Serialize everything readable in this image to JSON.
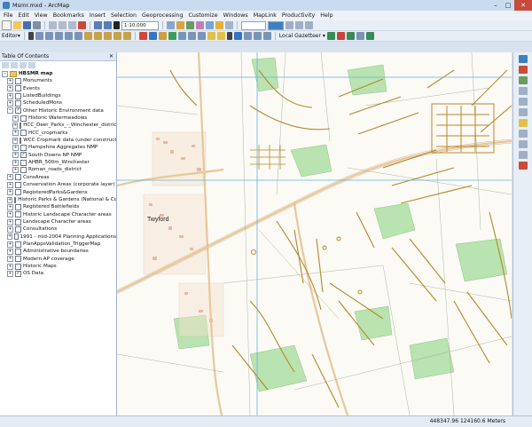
{
  "window": {
    "title": "Msmr.mxd - ArcMap",
    "minimize": "–",
    "maximize": "□",
    "close": "✕"
  },
  "menus": [
    "File",
    "Edit",
    "View",
    "Bookmarks",
    "Insert",
    "Selection",
    "Geoprocessing",
    "Customize",
    "Windows",
    "MapLink",
    "Productivity",
    "Help"
  ],
  "toolbar": {
    "scale": "1:10,000",
    "editor_label": "Editor▾",
    "gazetteer_label": "Local Gazetteer ▾"
  },
  "toc": {
    "title": "Table Of Contents",
    "close": "✕",
    "layers": [
      {
        "label": "HBSMR map",
        "depth": 0,
        "expander": "−",
        "checkbox": "",
        "group": true
      },
      {
        "label": "Monuments",
        "depth": 1,
        "expander": "+",
        "checkbox": ""
      },
      {
        "label": "Events",
        "depth": 1,
        "expander": "+",
        "checkbox": ""
      },
      {
        "label": "ListedBuildings",
        "depth": 1,
        "expander": "+",
        "checkbox": ""
      },
      {
        "label": "ScheduledMons",
        "depth": 1,
        "expander": "+",
        "checkbox": ""
      },
      {
        "label": "Other Historic Environment data",
        "depth": 1,
        "expander": "−",
        "checkbox": "✓"
      },
      {
        "label": "Historic Watermeadows",
        "depth": 2,
        "expander": "+",
        "checkbox": ""
      },
      {
        "label": "HCC_Deer_Parks_-_Winchester_district",
        "depth": 2,
        "expander": "+",
        "checkbox": ""
      },
      {
        "label": "HCC_cropmarks",
        "depth": 2,
        "expander": "+",
        "checkbox": ""
      },
      {
        "label": "WCC Cropmark data (under construction)",
        "depth": 2,
        "expander": "+",
        "checkbox": ""
      },
      {
        "label": "Hampshire Aggregates NMP",
        "depth": 2,
        "expander": "+",
        "checkbox": ""
      },
      {
        "label": "South Downs NP NMP",
        "depth": 2,
        "expander": "+",
        "checkbox": "✓"
      },
      {
        "label": "AHBR_500m_Winchester",
        "depth": 2,
        "expander": "+",
        "checkbox": ""
      },
      {
        "label": "Roman_roads_district",
        "depth": 2,
        "expander": "+",
        "checkbox": ""
      },
      {
        "label": "ConsAreas",
        "depth": 1,
        "expander": "+",
        "checkbox": ""
      },
      {
        "label": "Conservation Areas (corporate layer)",
        "depth": 1,
        "expander": "+",
        "checkbox": ""
      },
      {
        "label": "RegisteredParks&Gardens",
        "depth": 1,
        "expander": "+",
        "checkbox": ""
      },
      {
        "label": "Historic Parks & Gardens (National & County)",
        "depth": 1,
        "expander": "+",
        "checkbox": ""
      },
      {
        "label": "Registered Battlefields",
        "depth": 1,
        "expander": "+",
        "checkbox": ""
      },
      {
        "label": "Historic Landscape Character areas",
        "depth": 1,
        "expander": "+",
        "checkbox": ""
      },
      {
        "label": "Landscape Character areas",
        "depth": 1,
        "expander": "+",
        "checkbox": ""
      },
      {
        "label": "Consultations",
        "depth": 1,
        "expander": "+",
        "checkbox": ""
      },
      {
        "label": "1991 - mid-2004 Planning Applications",
        "depth": 1,
        "expander": "+",
        "checkbox": ""
      },
      {
        "label": "PlanAppsValidation_TriggerMap",
        "depth": 1,
        "expander": "+",
        "checkbox": ""
      },
      {
        "label": "Administrative boundaries",
        "depth": 1,
        "expander": "+",
        "checkbox": ""
      },
      {
        "label": "Modern AP coverage",
        "depth": 1,
        "expander": "+",
        "checkbox": ""
      },
      {
        "label": "Historic Maps",
        "depth": 1,
        "expander": "+",
        "checkbox": ""
      },
      {
        "label": "OS Data",
        "depth": 1,
        "expander": "+",
        "checkbox": "✓"
      }
    ]
  },
  "map": {
    "place_label": "Twyford"
  },
  "status": {
    "coordinates": "448347.96  124160.6 Meters"
  },
  "colors": {
    "accent": "#3d7fc1",
    "feature": "#b8862b",
    "green": "#b9e3b0",
    "grid": "#5fb6df",
    "road": "#e8c79a"
  }
}
